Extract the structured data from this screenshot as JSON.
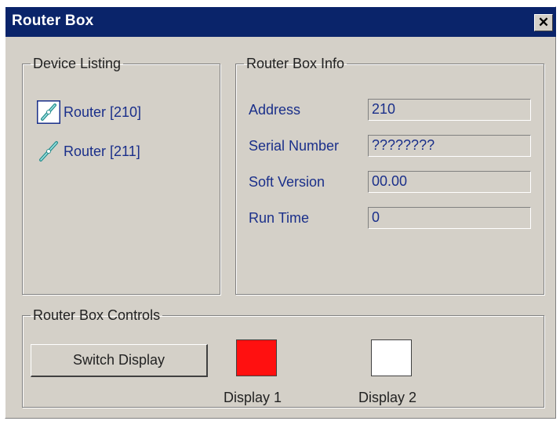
{
  "window": {
    "title": "Router Box",
    "close_symbol": "✕"
  },
  "device_listing": {
    "legend": "Device Listing",
    "items": [
      {
        "label": "Router [210]",
        "icon": "link-icon",
        "selected": true
      },
      {
        "label": "Router [211]",
        "icon": "link-icon",
        "selected": false
      }
    ]
  },
  "router_info": {
    "legend": "Router Box Info",
    "fields": [
      {
        "label": "Address",
        "value": "210"
      },
      {
        "label": "Serial Number",
        "value": "????????"
      },
      {
        "label": "Soft Version",
        "value": "00.00"
      },
      {
        "label": "Run Time",
        "value": "0"
      }
    ]
  },
  "controls": {
    "legend": "Router Box Controls",
    "switch_label": "Switch Display",
    "displays": [
      {
        "label": "Display 1",
        "color": "#ff1010"
      },
      {
        "label": "Display 2",
        "color": "#ffffff"
      }
    ]
  },
  "colors": {
    "titlebar": "#0a246a",
    "face": "#d4d0c8",
    "label_text": "#1a2f8a"
  }
}
